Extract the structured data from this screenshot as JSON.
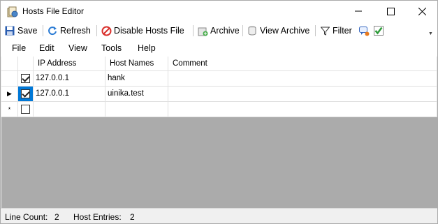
{
  "window": {
    "title": "Hosts File Editor",
    "icon": "hosts-app-icon"
  },
  "toolbar": {
    "save_label": "Save",
    "refresh_label": "Refresh",
    "disable_label": "Disable Hosts File",
    "archive_label": "Archive",
    "view_archive_label": "View Archive",
    "filter_label": "Filter"
  },
  "menu": {
    "file": "File",
    "edit": "Edit",
    "view": "View",
    "tools": "Tools",
    "help": "Help"
  },
  "grid": {
    "columns": {
      "ip": "IP Address",
      "host": "Host Names",
      "comment": "Comment"
    },
    "rows": [
      {
        "enabled": true,
        "ip": "127.0.0.1",
        "host": "hank",
        "comment": ""
      },
      {
        "enabled": true,
        "ip": "127.0.0.1",
        "host": "uinika.test",
        "comment": ""
      }
    ],
    "new_row_marker": "*"
  },
  "status": {
    "line_count_label": "Line Count:",
    "line_count": "2",
    "host_entries_label": "Host Entries:",
    "host_entries": "2"
  },
  "colors": {
    "selection": "#0078d7",
    "grid_empty_bg": "#ababab",
    "disable_red": "#d9302c",
    "refresh_blue": "#2a7bd4",
    "save_blue": "#2a5db0"
  }
}
